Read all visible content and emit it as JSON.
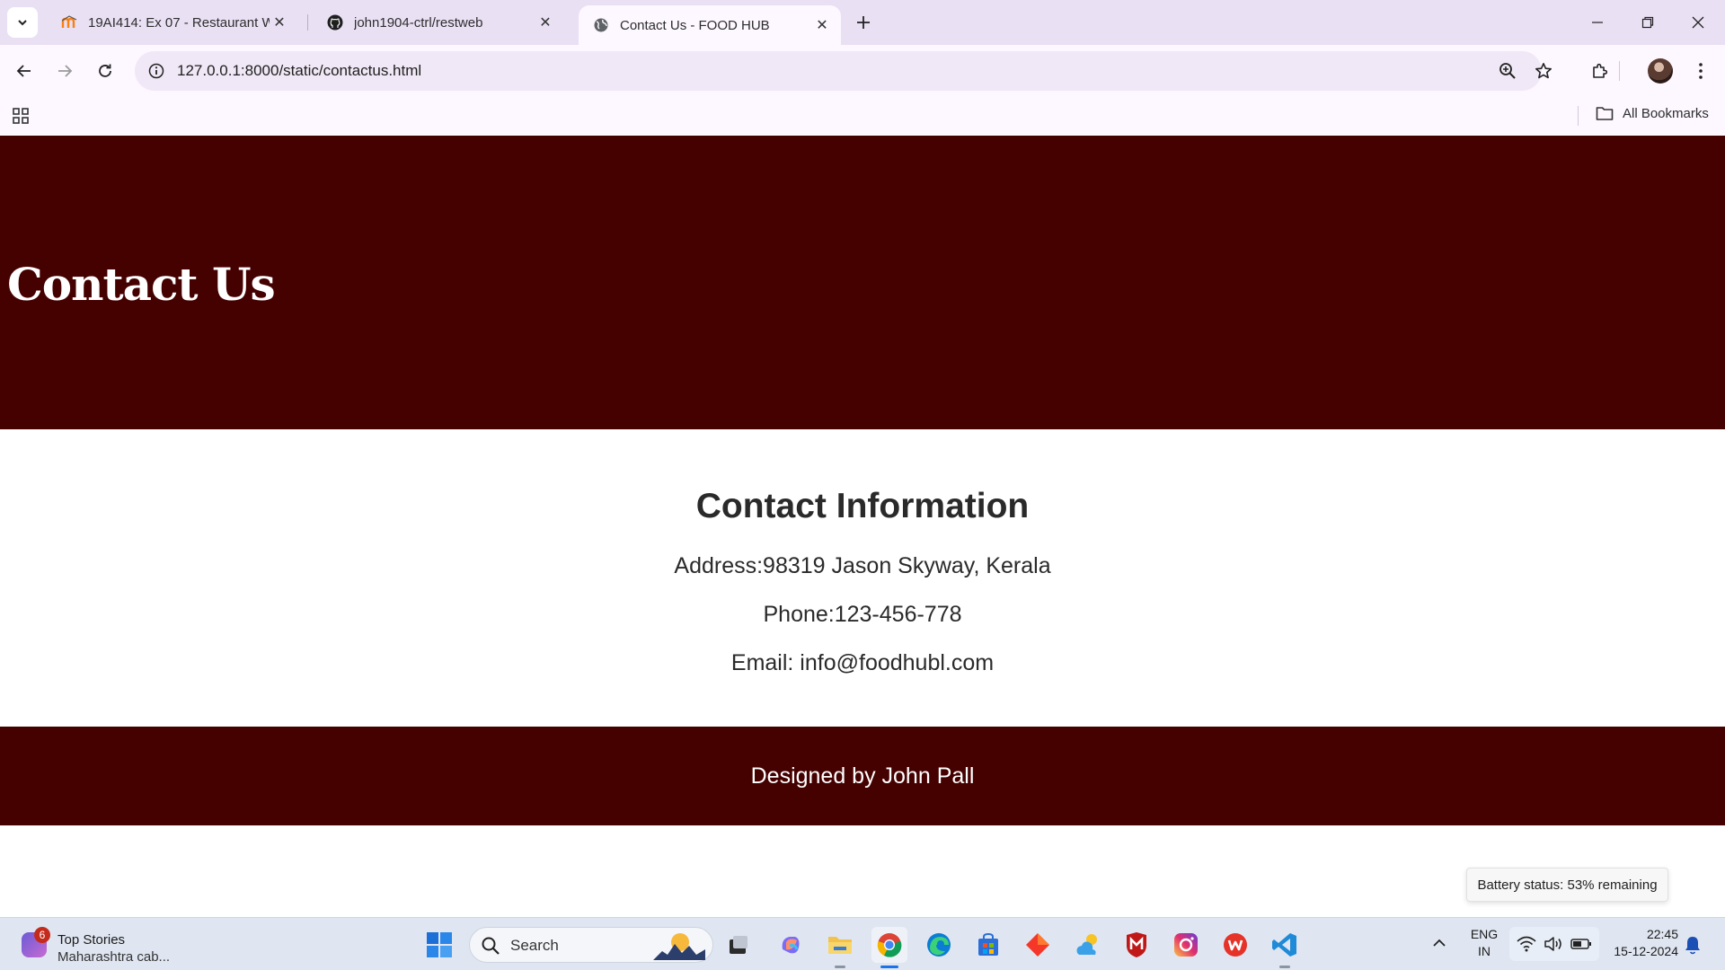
{
  "browser": {
    "tabs": [
      {
        "title": "19AI414: Ex 07 - Restaurant We",
        "icon": "moodle-icon",
        "active": false
      },
      {
        "title": "john1904-ctrl/restweb",
        "icon": "github-icon",
        "active": false
      },
      {
        "title": "Contact Us - FOOD HUB",
        "icon": "globe-icon",
        "active": true
      }
    ],
    "url": "127.0.0.1:8000/static/contactus.html",
    "bookmarks_label": "All Bookmarks"
  },
  "page": {
    "hero_title": "Contact Us",
    "section_title": "Contact Information",
    "address": "Address:98319 Jason Skyway, Kerala",
    "phone": "Phone:123-456-778",
    "email": "Email: info@foodhubl.com",
    "footer_text": "Designed by John Pall",
    "colors": {
      "header_bg": "#450000",
      "footer_bg": "#450000",
      "text": "#2a2a2a"
    }
  },
  "tooltip": "Battery status: 53% remaining",
  "taskbar": {
    "widget_badge": "6",
    "widget_title": "Top Stories",
    "widget_subtitle": "Maharashtra cab...",
    "search_label": "Search",
    "lang_top": "ENG",
    "lang_bottom": "IN",
    "time": "22:45",
    "date": "15-12-2024"
  }
}
